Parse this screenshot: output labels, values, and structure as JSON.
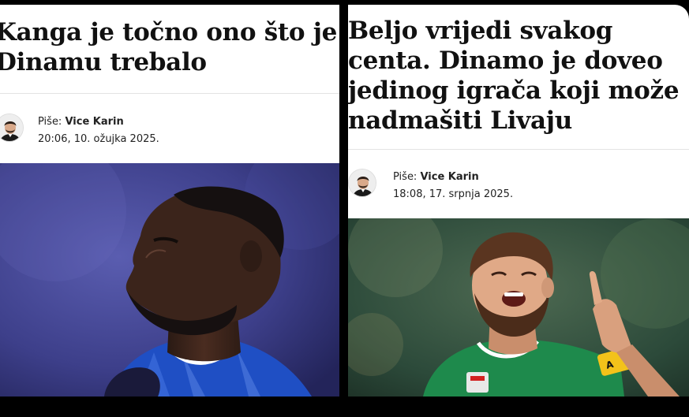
{
  "articles": [
    {
      "headline": "Kanga je točno ono što je Dinamu trebalo",
      "byline_prefix": "Piše: ",
      "author": "Vice Karin",
      "datetime": "20:06, 10. ožujka 2025."
    },
    {
      "headline": "Beljo vrijedi svakog centa. Dinamo je doveo jedinog igrača koji može nadmašiti Livaju",
      "byline_prefix": "Piše: ",
      "author": "Vice Karin",
      "datetime": "18:08, 17. srpnja 2025."
    }
  ],
  "colors": {
    "background": "#000000",
    "card": "#ffffff",
    "left_photo_bg": "#3d3f8a",
    "right_photo_bg": "#2c4a3a",
    "dinamo_blue": "#1f4fc4",
    "rapid_green": "#1e8a4c"
  }
}
